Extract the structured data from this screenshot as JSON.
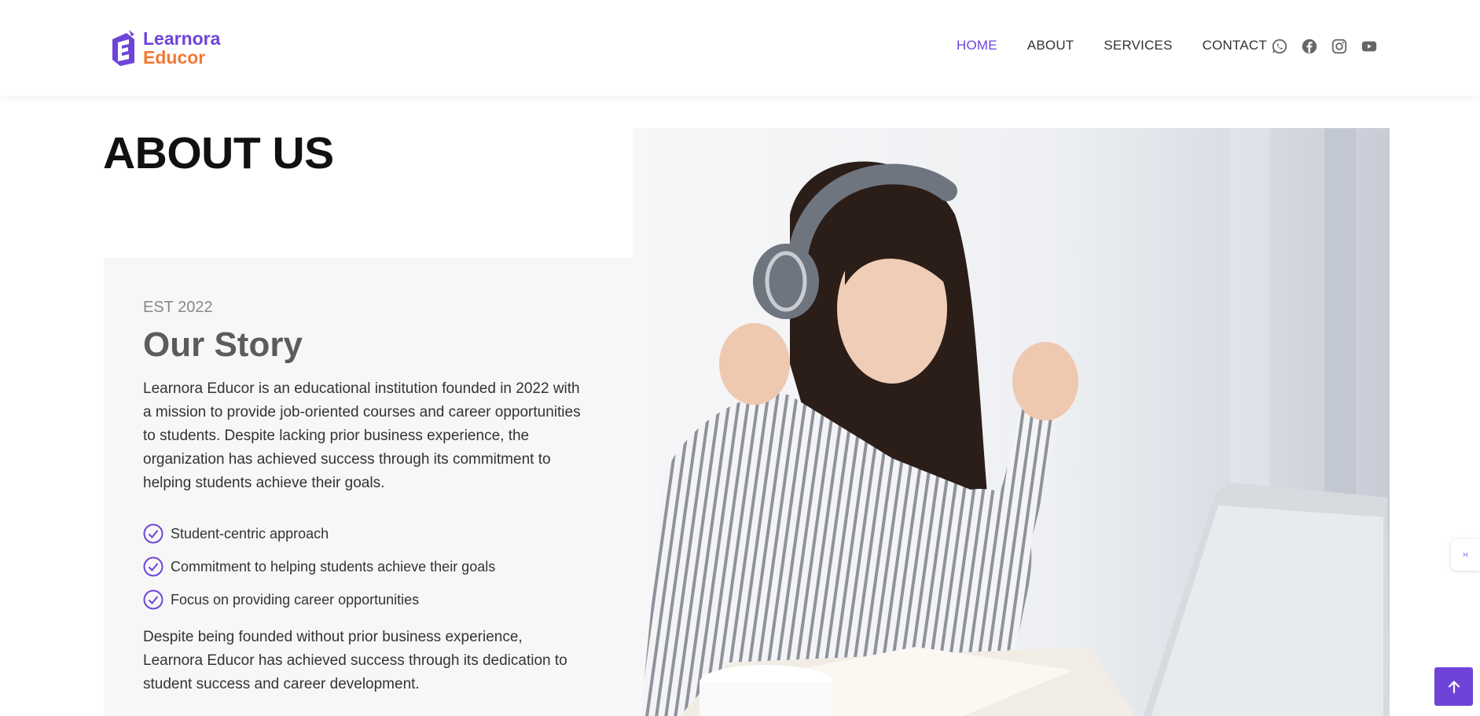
{
  "brand": {
    "line1": "Learnora",
    "line2": "Educor",
    "primary_color": "#6e44d8",
    "accent_color": "#f07a34"
  },
  "nav": {
    "items": [
      {
        "label": "HOME",
        "active": true
      },
      {
        "label": "ABOUT",
        "active": false
      },
      {
        "label": "SERVICES",
        "active": false
      },
      {
        "label": "CONTACT",
        "active": false
      }
    ]
  },
  "social": [
    "whatsapp-icon",
    "facebook-icon",
    "instagram-icon",
    "youtube-icon"
  ],
  "page": {
    "title": "ABOUT US"
  },
  "story": {
    "est": "EST 2022",
    "title": "Our Story",
    "paragraph1": "Learnora Educor is an educational institution founded in 2022 with a mission to provide job-oriented courses and career opportunities to students. Despite lacking prior business experience, the organization has achieved success through its commitment to helping students achieve their goals.",
    "features": [
      "Student-centric approach",
      "Commitment to helping students achieve their goals",
      "Focus on providing career opportunities"
    ],
    "paragraph2": "Despite being founded without prior business experience, Learnora Educor has achieved success through its dedication to student success and career development."
  },
  "widgets": {
    "side_widget_glyph": "›‹",
    "back_to_top_icon": "arrow-up-icon"
  }
}
